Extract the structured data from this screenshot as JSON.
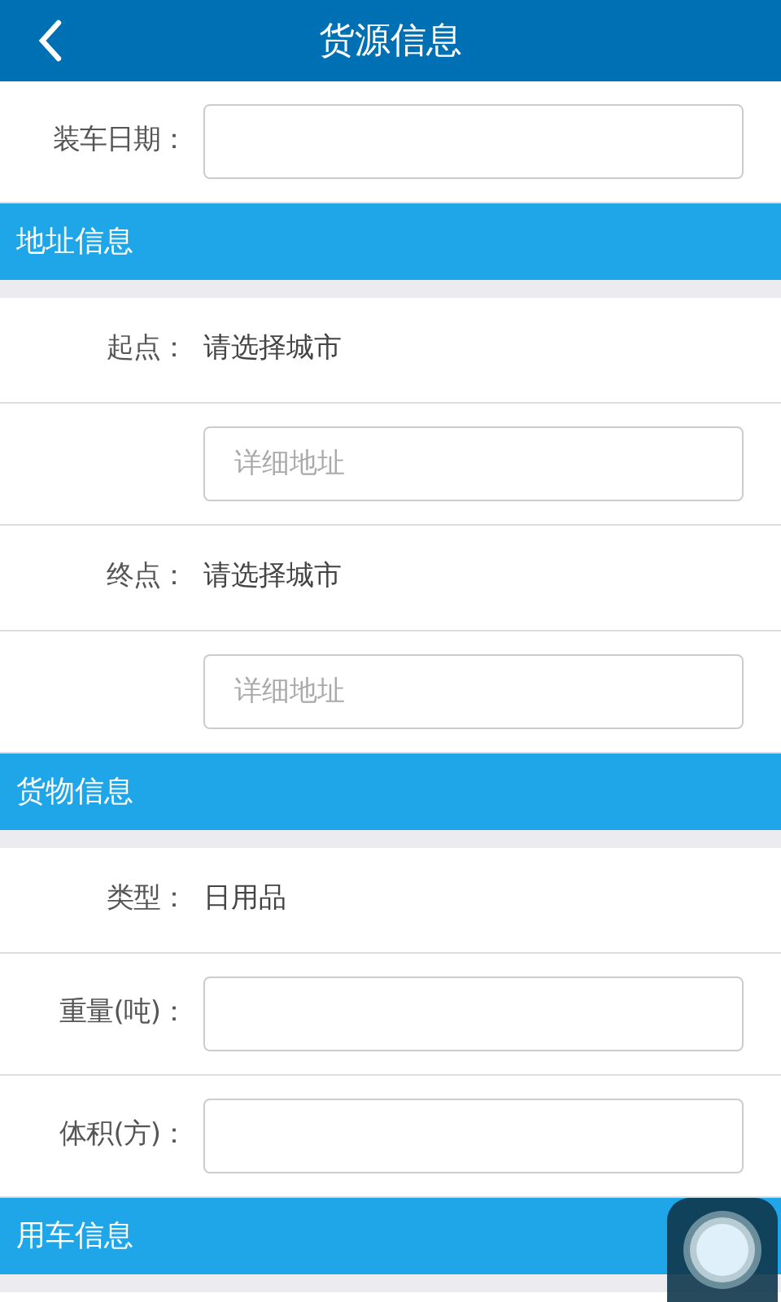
{
  "header": {
    "title": "货源信息"
  },
  "blocks": [
    {
      "kind": "input",
      "label": "装车日期："
    },
    {
      "kind": "section",
      "title": "地址信息"
    },
    {
      "kind": "picker",
      "label": "起点：",
      "value": "请选择城市"
    },
    {
      "kind": "input",
      "placeholder": "详细地址"
    },
    {
      "kind": "picker",
      "label": "终点：",
      "value": "请选择城市"
    },
    {
      "kind": "input",
      "placeholder": "详细地址"
    },
    {
      "kind": "section",
      "title": "货物信息"
    },
    {
      "kind": "picker",
      "label": "类型：",
      "value": "日用品"
    },
    {
      "kind": "input",
      "label": "重量(吨)："
    },
    {
      "kind": "input",
      "label": "体积(方)："
    },
    {
      "kind": "section",
      "title": "用车信息"
    }
  ]
}
